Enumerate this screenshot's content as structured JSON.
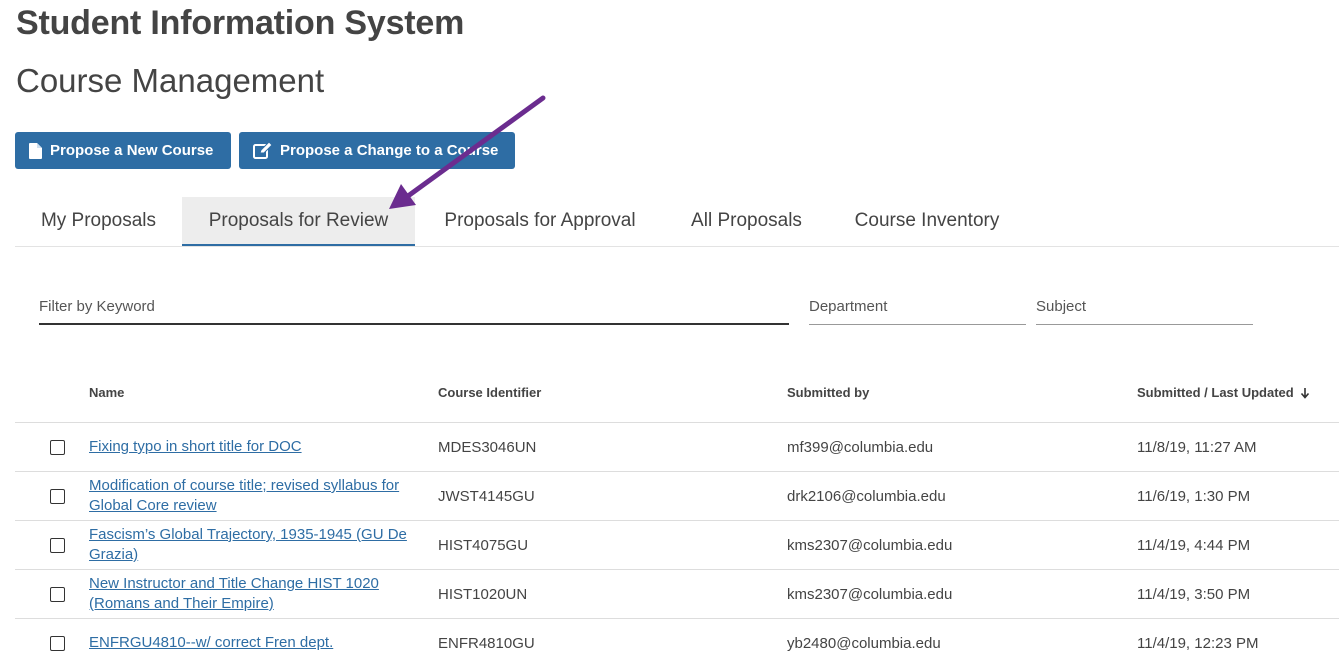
{
  "header": {
    "system_title": "Student Information System",
    "module_title": "Course Management"
  },
  "actions": {
    "new_course": "Propose a New Course",
    "change_course": "Propose a Change to a Course"
  },
  "tabs": [
    {
      "label": "My Proposals",
      "active": false
    },
    {
      "label": "Proposals for Review",
      "active": true
    },
    {
      "label": "Proposals for Approval",
      "active": false
    },
    {
      "label": "All Proposals",
      "active": false
    },
    {
      "label": "Course Inventory",
      "active": false
    }
  ],
  "filters": {
    "keyword_placeholder": "Filter by Keyword",
    "department_placeholder": "Department",
    "subject_placeholder": "Subject"
  },
  "table": {
    "columns": {
      "name": "Name",
      "course_id": "Course Identifier",
      "submitted_by": "Submitted by",
      "updated": "Submitted / Last Updated"
    },
    "rows": [
      {
        "name": "Fixing typo in short title for DOC",
        "course_id": "MDES3046UN",
        "submitted_by": "mf399@columbia.edu",
        "updated": "11/8/19, 11:27 AM"
      },
      {
        "name": "Modification of course title; revised syllabus for Global Core review",
        "course_id": "JWST4145GU",
        "submitted_by": "drk2106@columbia.edu",
        "updated": "11/6/19, 1:30 PM"
      },
      {
        "name": "Fascism’s Global Trajectory, 1935-1945 (GU De Grazia)",
        "course_id": "HIST4075GU",
        "submitted_by": "kms2307@columbia.edu",
        "updated": "11/4/19, 4:44 PM"
      },
      {
        "name": "New Instructor and Title Change HIST 1020 (Romans and Their Empire)",
        "course_id": "HIST1020UN",
        "submitted_by": "kms2307@columbia.edu",
        "updated": "11/4/19, 3:50 PM"
      },
      {
        "name": "ENFRGU4810--w/ correct Fren dept.",
        "course_id": "ENFR4810GU",
        "submitted_by": "yb2480@columbia.edu",
        "updated": "11/4/19, 12:23 PM"
      }
    ]
  },
  "colors": {
    "primary": "#2e6da4",
    "annotation_arrow": "#6b2c8f"
  },
  "icons": {
    "new_course": "document-icon",
    "change_course": "edit-icon",
    "sort": "arrow-down-icon"
  }
}
